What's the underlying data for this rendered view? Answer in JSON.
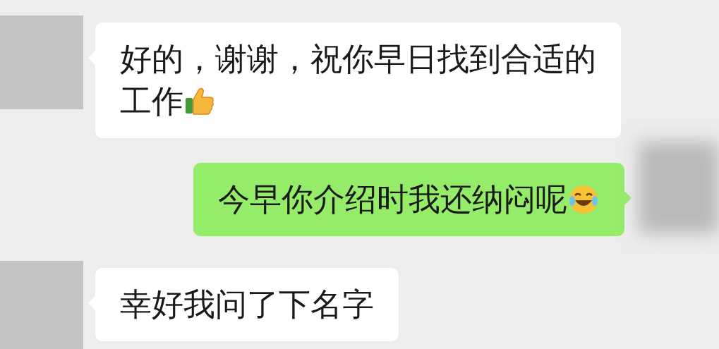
{
  "messages": [
    {
      "kind": "incoming",
      "lines": [
        "好的，谢谢，祝你早日找到合适的",
        "工作"
      ]
    },
    {
      "kind": "outgoing",
      "lines": [
        "今早你介绍时我还纳闷呢"
      ]
    },
    {
      "kind": "incoming",
      "lines": [
        "幸好我问了下名字"
      ]
    }
  ]
}
